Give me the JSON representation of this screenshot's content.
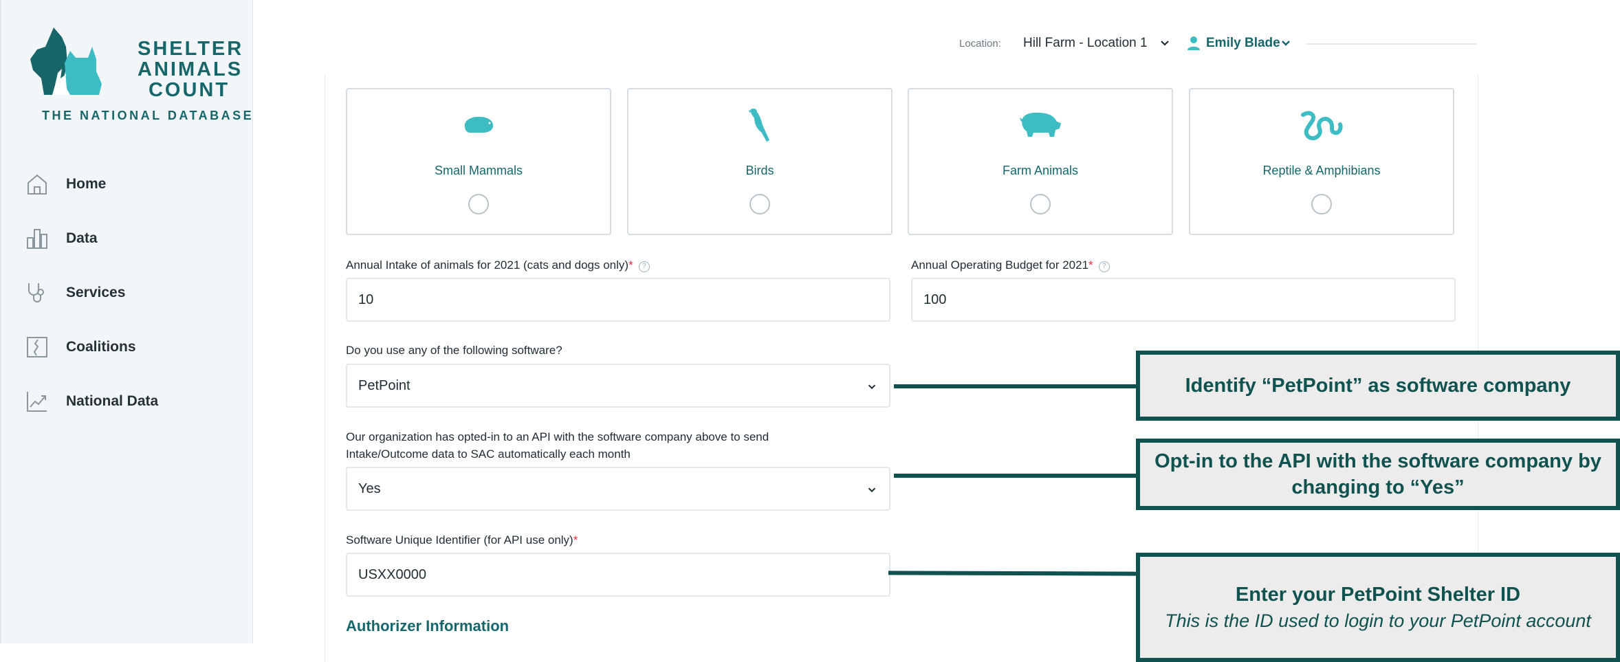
{
  "brand": {
    "logo_line1": "SHELTER",
    "logo_line2": "ANIMALS",
    "logo_line3": "COUNT",
    "logo_sub": "THE NATIONAL DATABASE",
    "color": "#16666a",
    "accent": "#3dbcc4"
  },
  "sidebar": {
    "items": [
      {
        "label": "Home",
        "icon": "home-icon"
      },
      {
        "label": "Data",
        "icon": "bar-chart-icon"
      },
      {
        "label": "Services",
        "icon": "stethoscope-icon"
      },
      {
        "label": "Coalitions",
        "icon": "map-icon"
      },
      {
        "label": "National Data",
        "icon": "trend-chart-icon"
      }
    ]
  },
  "header": {
    "location_label": "Location:",
    "location_value": "Hill Farm - Location 1",
    "user_name": "Emily Blade"
  },
  "animal_types": [
    {
      "label": "Small Mammals",
      "icon": "guinea-pig-icon",
      "selected": false
    },
    {
      "label": "Birds",
      "icon": "bird-icon",
      "selected": false
    },
    {
      "label": "Farm Animals",
      "icon": "pig-icon",
      "selected": false
    },
    {
      "label": "Reptile & Amphibians",
      "icon": "snake-icon",
      "selected": false
    }
  ],
  "form": {
    "intake_label": "Annual Intake of animals for 2021 (cats and dogs only)",
    "intake_value": "10",
    "budget_label": "Annual Operating Budget for 2021",
    "budget_value": "100",
    "software_label": "Do you use any of the following software?",
    "software_value": "PetPoint",
    "api_label_line1": "Our organization has opted-in to an API with the software company above to send",
    "api_label_line2": "Intake/Outcome data to SAC automatically each month",
    "api_value": "Yes",
    "identifier_label": "Software Unique Identifier (for API use only)",
    "identifier_value": "USXX0000",
    "required_mark": "*",
    "help_mark": "?",
    "section_title": "Authorizer Information"
  },
  "callouts": {
    "software": "Identify “PetPoint” as software company",
    "api_line1": "Opt-in to the API with the software company by",
    "api_line2": "changing to “Yes”",
    "id_line1": "Enter your PetPoint Shelter ID",
    "id_line2": "This is the ID used to login to your PetPoint account",
    "color": "#0f5250"
  }
}
